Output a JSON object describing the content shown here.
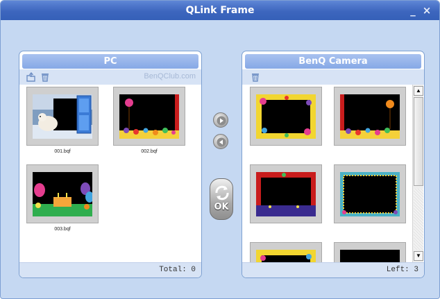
{
  "window": {
    "title": "QLink Frame",
    "minimize_label": "_",
    "close_label": "×"
  },
  "left_panel": {
    "title": "PC",
    "brand": "BenQClub.com",
    "toolbar_icons": [
      "import-icon",
      "trash-icon"
    ],
    "items": [
      {
        "caption": "001.bqf",
        "frame": "polar-bear-window"
      },
      {
        "caption": "002.bqf",
        "frame": "candy-balloon"
      },
      {
        "caption": "003.bqf",
        "frame": "party-balloons"
      }
    ],
    "status": "Total: 0"
  },
  "right_panel": {
    "title": "BenQ Camera",
    "toolbar_icons": [
      "trash-icon"
    ],
    "items": [
      {
        "frame": "yellow-hearts"
      },
      {
        "frame": "candy-balloon"
      },
      {
        "frame": "red-curtain-stage"
      },
      {
        "frame": "green-dotted-border"
      },
      {
        "frame": "yellow-flowers"
      },
      {
        "frame": "plain-black"
      }
    ],
    "status": "Left: 3"
  },
  "controls": {
    "send_right_icon": "arrow-right-icon",
    "send_left_icon": "arrow-left-icon",
    "ok_label": "OK"
  },
  "colors": {
    "window_bg": "#c5d8f2",
    "title_bar": "#3d66be",
    "panel_header": "#94b2e9",
    "status_bar": "#d7e3f5",
    "thumb_bg": "#cfcfcf"
  }
}
